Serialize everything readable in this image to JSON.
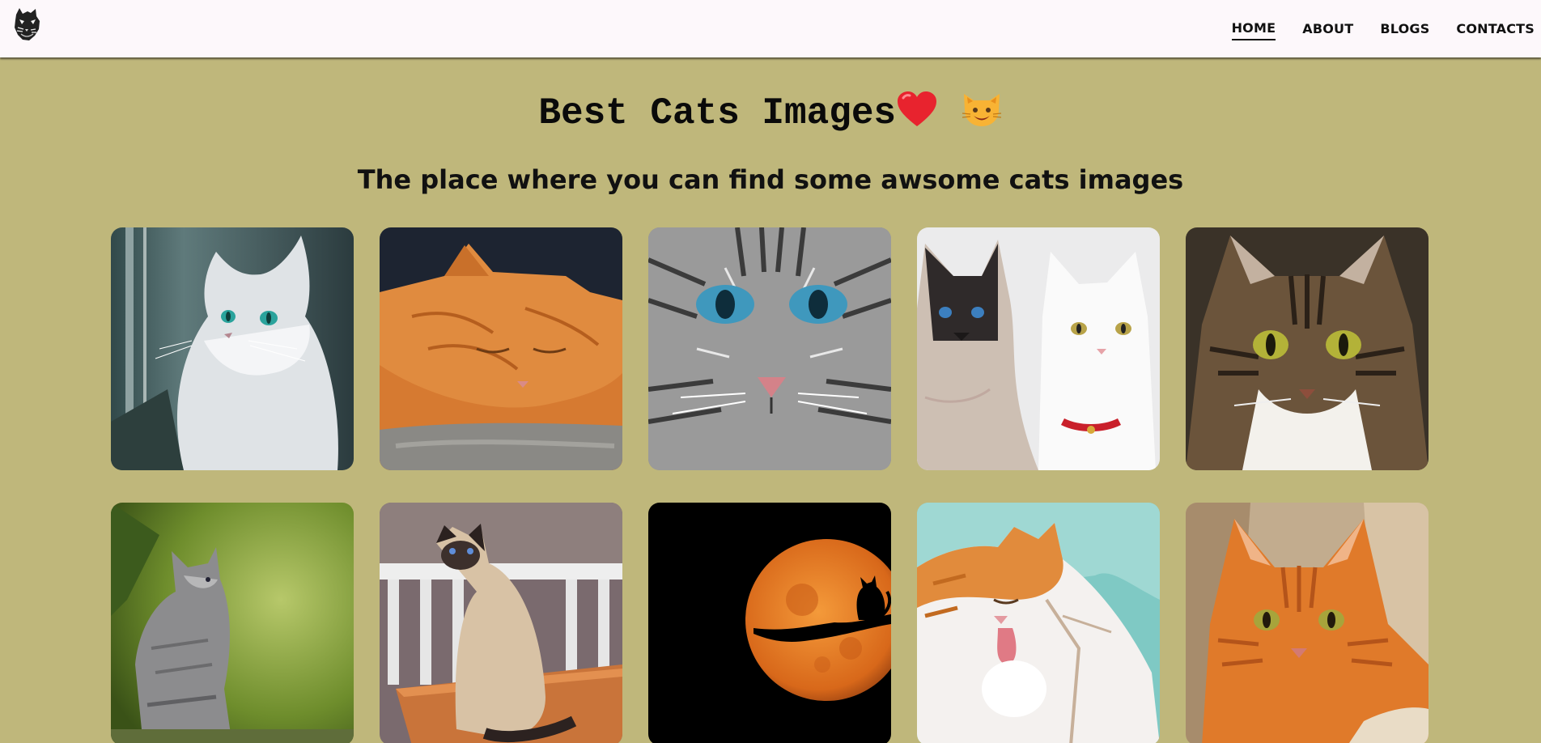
{
  "header": {
    "logo_icon": "cat-head-logo-icon",
    "nav": [
      {
        "label": "HOME",
        "active": true
      },
      {
        "label": "ABOUT",
        "active": false
      },
      {
        "label": "BLOGS",
        "active": false
      },
      {
        "label": "CONTACTS",
        "active": false
      }
    ]
  },
  "hero": {
    "title": "Best Cats Images",
    "title_icons": [
      "red-heart-icon",
      "grinning-cat-icon"
    ],
    "subtitle": "The place where you can find some awsome cats images"
  },
  "gallery": {
    "images": [
      {
        "icon": "fluffy-white-cat-photo"
      },
      {
        "icon": "sleeping-orange-cat-photo"
      },
      {
        "icon": "grey-tabby-closeup-photo"
      },
      {
        "icon": "siamese-and-white-cats-photo"
      },
      {
        "icon": "brown-tabby-cat-photo"
      },
      {
        "icon": "grey-kitten-photo"
      },
      {
        "icon": "siamese-cat-sitting-photo"
      },
      {
        "icon": "cat-silhouette-moon-photo"
      },
      {
        "icon": "cat-licking-paw-photo"
      },
      {
        "icon": "ginger-cat-lying-photo"
      }
    ]
  },
  "colors": {
    "page_background": "#bfb77b",
    "navbar_background": "#fdf8fb",
    "text": "#111111"
  }
}
